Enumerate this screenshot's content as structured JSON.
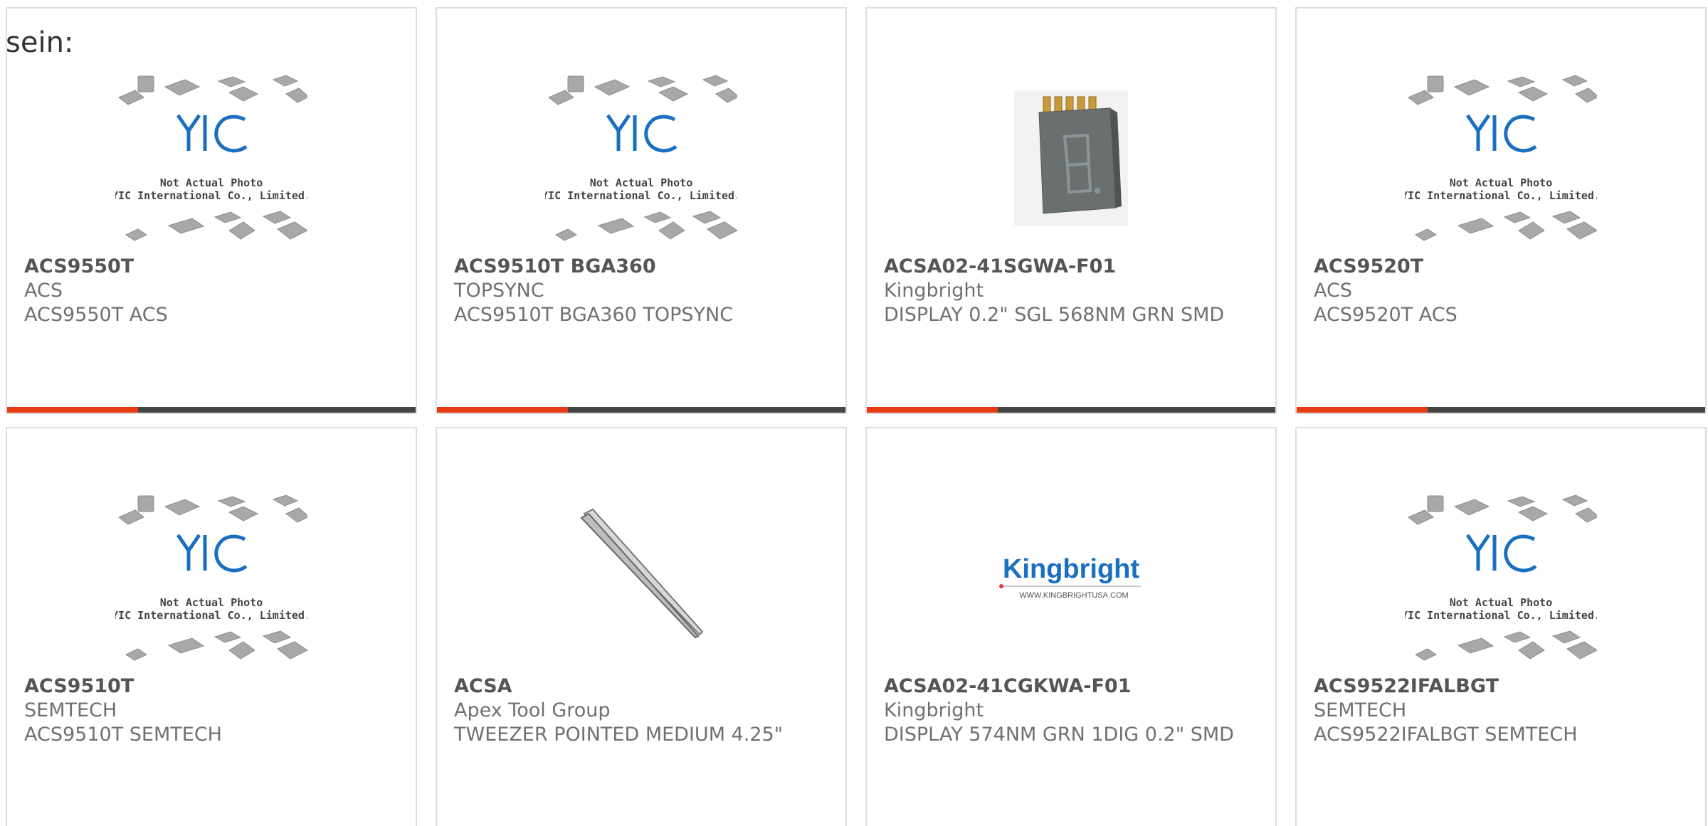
{
  "prefix_text": "sein:",
  "placeholder_caption": {
    "line1": "Not Actual Photo",
    "line2": "YIC International Co., Limited.",
    "logo": "YIC"
  },
  "kingbright_logo": {
    "name": "Kingbright",
    "url": "WWW.KINGBRIGHTUSA.COM"
  },
  "colors": {
    "accent": "#e83a10",
    "bar": "#444444",
    "logo_blue": "#1a6fc0"
  },
  "products": [
    {
      "part": "ACS9550T",
      "brand": "ACS",
      "desc": "ACS9550T ACS",
      "image": "yic-placeholder"
    },
    {
      "part": "ACS9510T BGA360",
      "brand": "TOPSYNC",
      "desc": "ACS9510T BGA360 TOPSYNC",
      "image": "yic-placeholder"
    },
    {
      "part": "ACSA02-41SGWA-F01",
      "brand": "Kingbright",
      "desc": "DISPLAY 0.2\" SGL 568NM GRN SMD",
      "image": "seven-segment-display"
    },
    {
      "part": "ACS9520T",
      "brand": "ACS",
      "desc": "ACS9520T ACS",
      "image": "yic-placeholder"
    },
    {
      "part": "ACS9510T",
      "brand": "SEMTECH",
      "desc": "ACS9510T SEMTECH",
      "image": "yic-placeholder"
    },
    {
      "part": "ACSA",
      "brand": "Apex Tool Group",
      "desc": "TWEEZER POINTED MEDIUM 4.25\"",
      "image": "tweezer"
    },
    {
      "part": "ACSA02-41CGKWA-F01",
      "brand": "Kingbright",
      "desc": "DISPLAY 574NM GRN 1DIG 0.2\" SMD",
      "image": "kingbright-logo"
    },
    {
      "part": "ACS9522IFALBGT",
      "brand": "SEMTECH",
      "desc": "ACS9522IFALBGT SEMTECH",
      "image": "yic-placeholder"
    }
  ]
}
